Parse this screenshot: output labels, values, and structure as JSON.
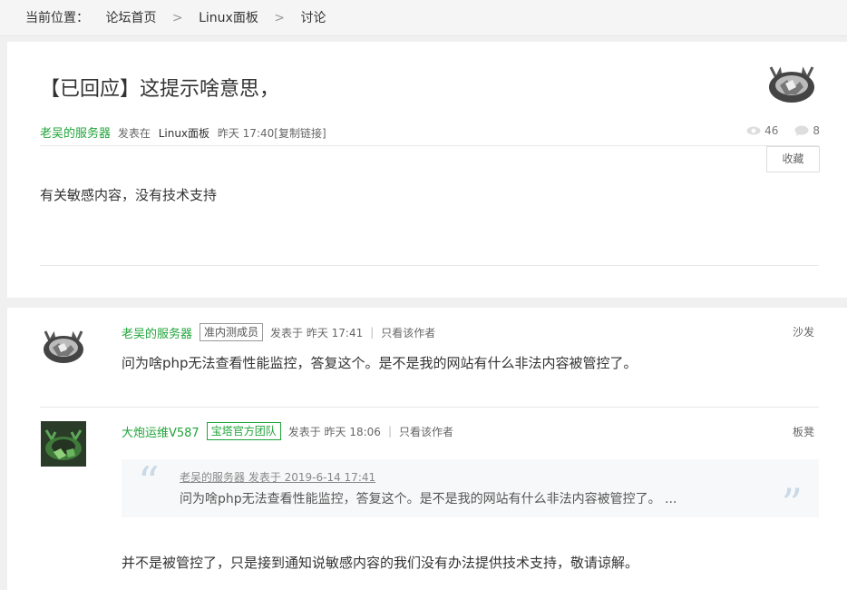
{
  "breadcrumb": {
    "lead": "当前位置：",
    "items": [
      "论坛首页",
      "Linux面板",
      "讨论"
    ],
    "separator": ">"
  },
  "post": {
    "title": "【已回应】这提示啥意思，",
    "author": "老吴的服务器",
    "posted_in": "发表在",
    "board": "Linux面板",
    "time": "昨天 17:40",
    "copy_link": "[复制链接]",
    "views": "46",
    "comments": "8",
    "favorite_label": "收藏",
    "body": "有关敏感内容，没有技术支持"
  },
  "replies": [
    {
      "author": "老吴的服务器",
      "tag": "准内测成员",
      "posted": "发表于 昨天 17:41",
      "only_author": "只看该作者",
      "floor": "沙发",
      "text": "问为啥php无法查看性能监控，答复这个。是不是我的网站有什么非法内容被管控了。"
    },
    {
      "author": "大炮运维V587",
      "tag": "宝塔官方团队",
      "posted": "发表于 昨天 18:06",
      "only_author": "只看该作者",
      "floor": "板凳",
      "quote_header": "老吴的服务器 发表于 2019-6-14 17:41",
      "quote_text": "问为啥php无法查看性能监控，答复这个。是不是我的网站有什么非法内容被管控了。 ...",
      "text": "并不是被管控了，只是接到通知说敏感内容的我们没有办法提供技术支持，敬请谅解。"
    }
  ],
  "colors": {
    "accent": "#20a53a",
    "quote_mark": "#c9d9e8"
  }
}
